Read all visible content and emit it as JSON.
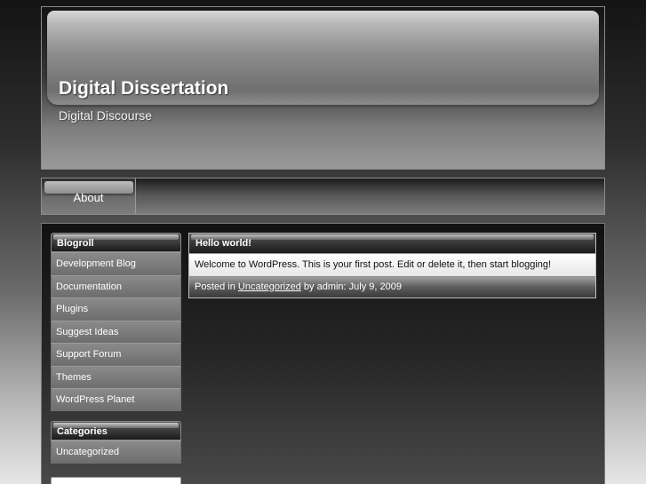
{
  "site": {
    "title": "Digital Dissertation",
    "description": "Digital Discourse"
  },
  "nav": {
    "items": [
      {
        "label": "About"
      }
    ]
  },
  "sidebar": {
    "blogroll": {
      "title": "Blogroll",
      "items": [
        {
          "label": "Development Blog"
        },
        {
          "label": "Documentation"
        },
        {
          "label": "Plugins"
        },
        {
          "label": "Suggest Ideas"
        },
        {
          "label": "Support Forum"
        },
        {
          "label": "Themes"
        },
        {
          "label": "WordPress Planet"
        }
      ]
    },
    "categories": {
      "title": "Categories",
      "items": [
        {
          "label": "Uncategorized"
        }
      ]
    }
  },
  "post": {
    "title": "Hello world!",
    "body": "Welcome to WordPress. This is your first post. Edit or delete it, then start blogging!",
    "meta": {
      "posted_in_prefix": "Posted in ",
      "category": "Uncategorized",
      "suffix": " by admin: July 9, 2009"
    }
  },
  "colors": {
    "page_background_top": "#141414",
    "page_background_bottom": "#e6e6e6",
    "text_primary": "#ffffff",
    "post_body_text": "#111111"
  }
}
